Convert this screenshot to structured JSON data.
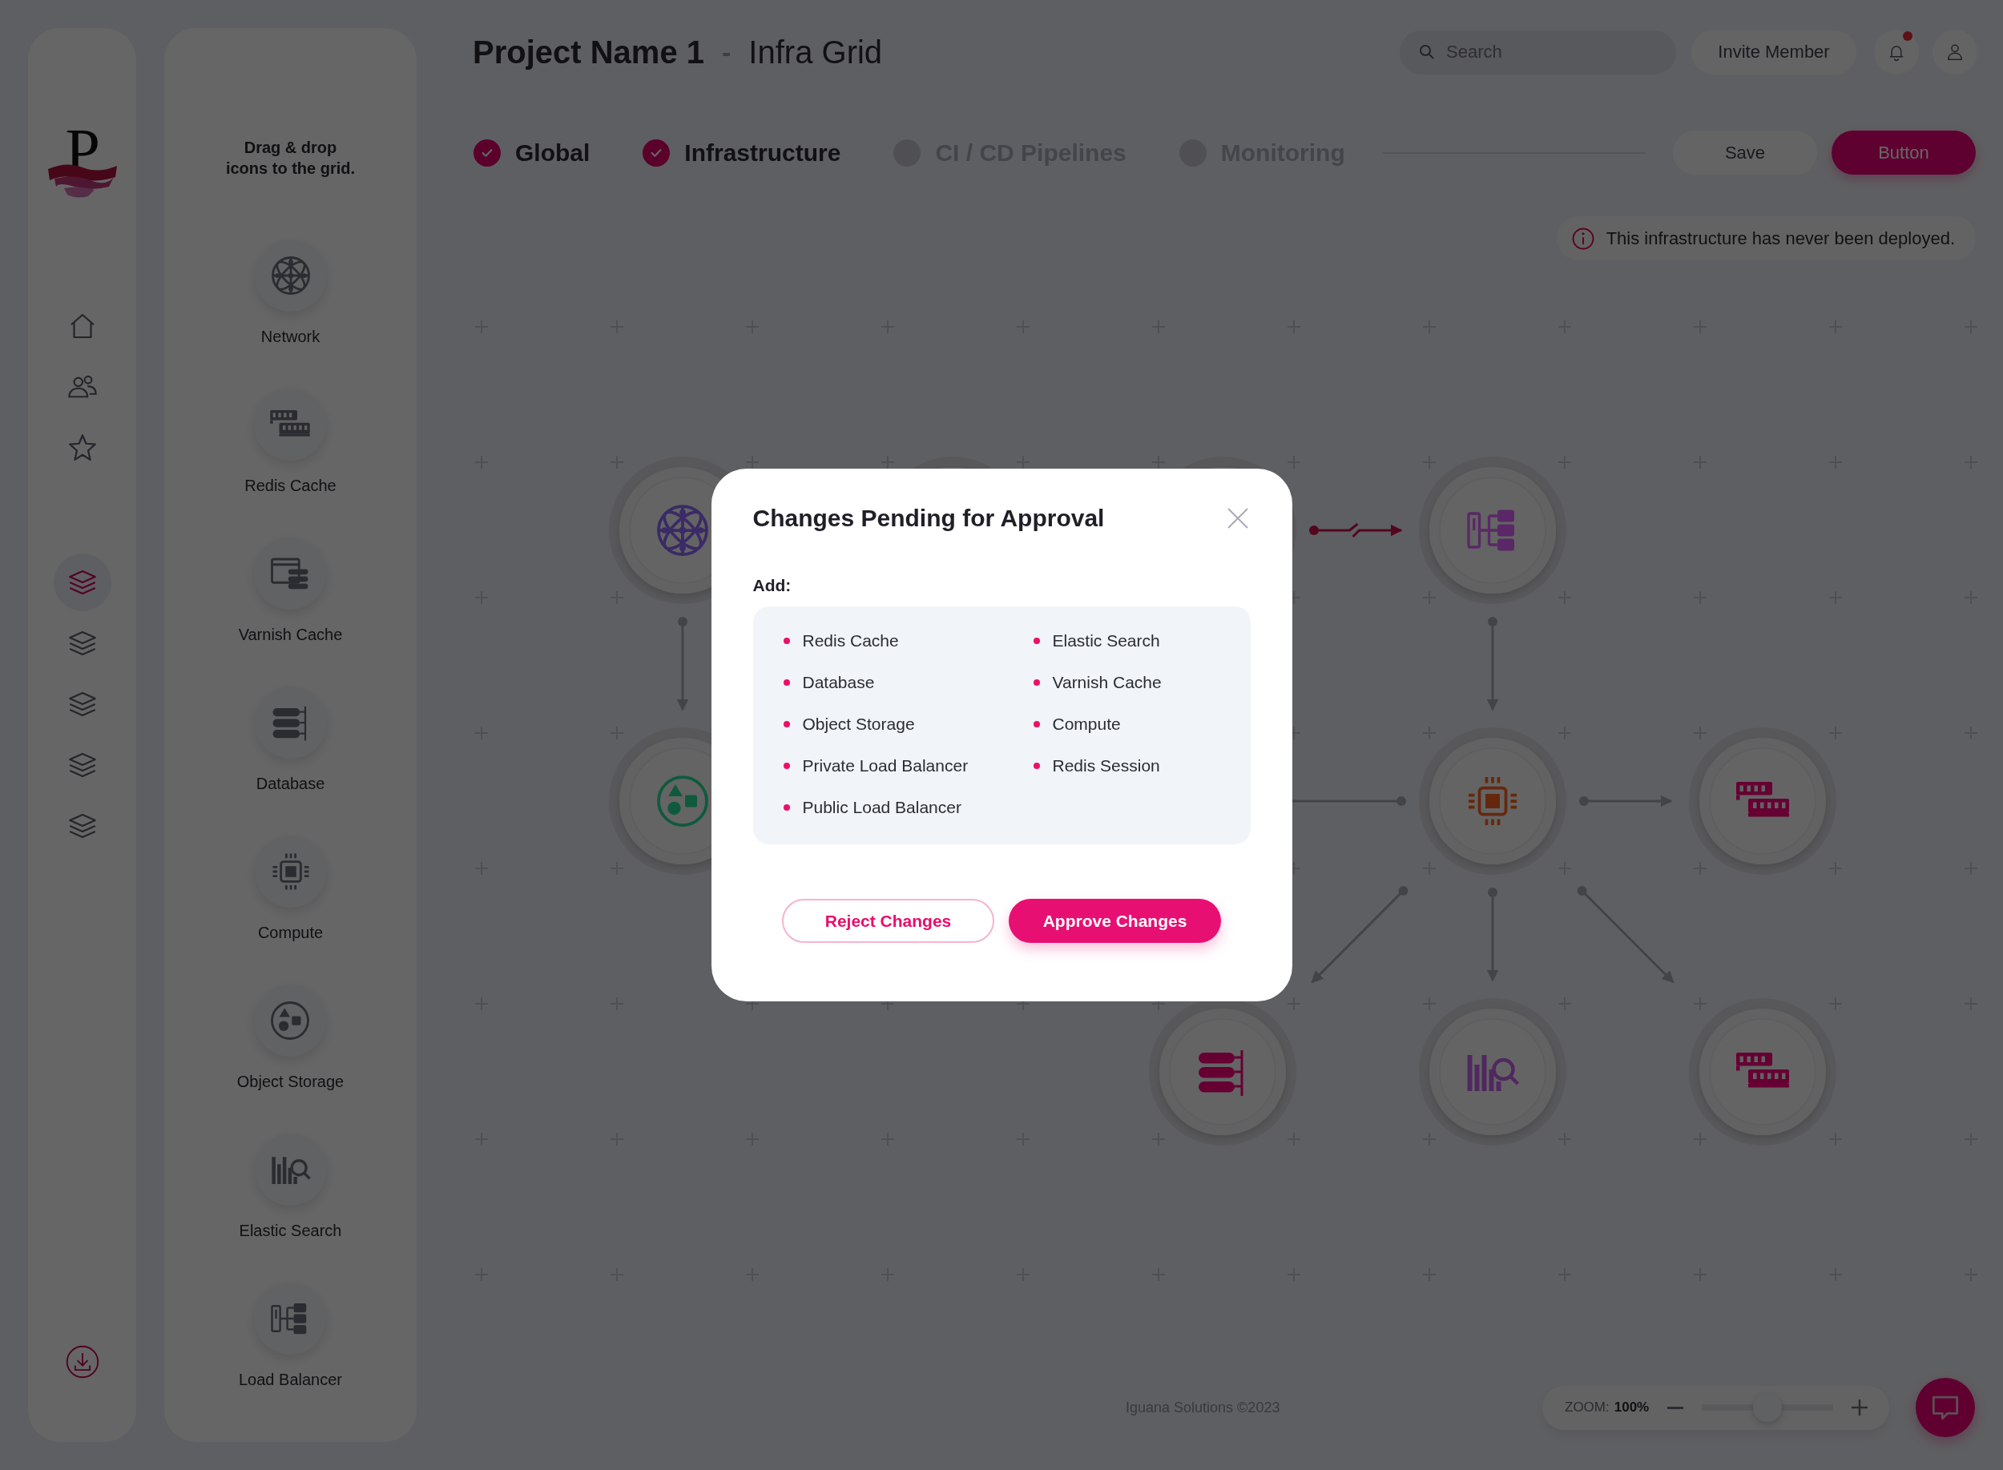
{
  "logo": {
    "letter": "P"
  },
  "nav": {
    "items": [
      {
        "kind": "home",
        "selected": false
      },
      {
        "kind": "users",
        "selected": false
      },
      {
        "kind": "star",
        "selected": false
      },
      {
        "kind": "layers",
        "selected": true
      },
      {
        "kind": "layers",
        "selected": false
      },
      {
        "kind": "layers",
        "selected": false
      },
      {
        "kind": "layers",
        "selected": false
      },
      {
        "kind": "layers",
        "selected": false
      }
    ],
    "download": {
      "kind": "download"
    }
  },
  "palette": {
    "hint": "Drag & drop\nicons to the grid.",
    "items": [
      {
        "label": "Network",
        "kind": "network"
      },
      {
        "label": "Redis Cache",
        "kind": "redis"
      },
      {
        "label": "Varnish Cache",
        "kind": "varnish"
      },
      {
        "label": "Database",
        "kind": "database"
      },
      {
        "label": "Compute",
        "kind": "compute"
      },
      {
        "label": "Object Storage",
        "kind": "object_storage"
      },
      {
        "label": "Elastic Search",
        "kind": "elastic"
      },
      {
        "label": "Load Balancer",
        "kind": "load_balancer"
      }
    ]
  },
  "header": {
    "project": "Project Name 1",
    "separator": "-",
    "subtitle": "Infra Grid",
    "search": {
      "placeholder": "Search"
    },
    "invite": "Invite Member",
    "notifications": {
      "unread": true
    }
  },
  "steps": [
    {
      "label": "Global",
      "done": true
    },
    {
      "label": "Infrastructure",
      "done": true
    },
    {
      "label": "CI / CD Pipelines",
      "done": false
    },
    {
      "label": "Monitoring",
      "done": false
    }
  ],
  "actions": [
    {
      "label": "Save",
      "kind": "secondary"
    },
    {
      "label": "Button",
      "kind": "primary"
    }
  ],
  "notice": "This infrastructure has never been deployed.",
  "canvas": {
    "nodes": [
      {
        "kind": "network",
        "color": "#3a2a66"
      },
      {
        "kind": "unknown"
      },
      {
        "kind": "unknown"
      },
      {
        "kind": "load_balancer",
        "color": "#5a2866"
      },
      {
        "kind": "object_storage",
        "color": "#0f5a3c"
      },
      {
        "kind": "compute",
        "color": "#66280c"
      },
      {
        "kind": "redis",
        "color": "#660033"
      },
      {
        "kind": "database",
        "color": "#660033"
      },
      {
        "kind": "elastic",
        "color": "#50285f"
      },
      {
        "kind": "redis",
        "color": "#660033"
      }
    ],
    "edges": [
      {
        "kind": "normal"
      },
      {
        "kind": "broken"
      },
      {
        "kind": "normal"
      },
      {
        "kind": "normal"
      },
      {
        "kind": "normal"
      },
      {
        "kind": "normal"
      },
      {
        "kind": "normal"
      },
      {
        "kind": "normal"
      }
    ]
  },
  "footer": {
    "copyright": "Iguana Solutions ©2023",
    "zoom": {
      "label": "ZOOM:",
      "value": "100%",
      "level": 0.5
    }
  },
  "modal": {
    "title": "Changes Pending for Approval",
    "section": "Add:",
    "items": [
      "Redis Cache",
      "Database",
      "Object Storage",
      "Private Load Balancer",
      "Public Load Balancer",
      "Elastic Search",
      "Varnish Cache",
      "Compute",
      "Redis Session"
    ],
    "buttons": [
      {
        "label": "Reject Changes",
        "kind": "secondary"
      },
      {
        "label": "Approve Changes",
        "kind": "primary"
      }
    ]
  }
}
